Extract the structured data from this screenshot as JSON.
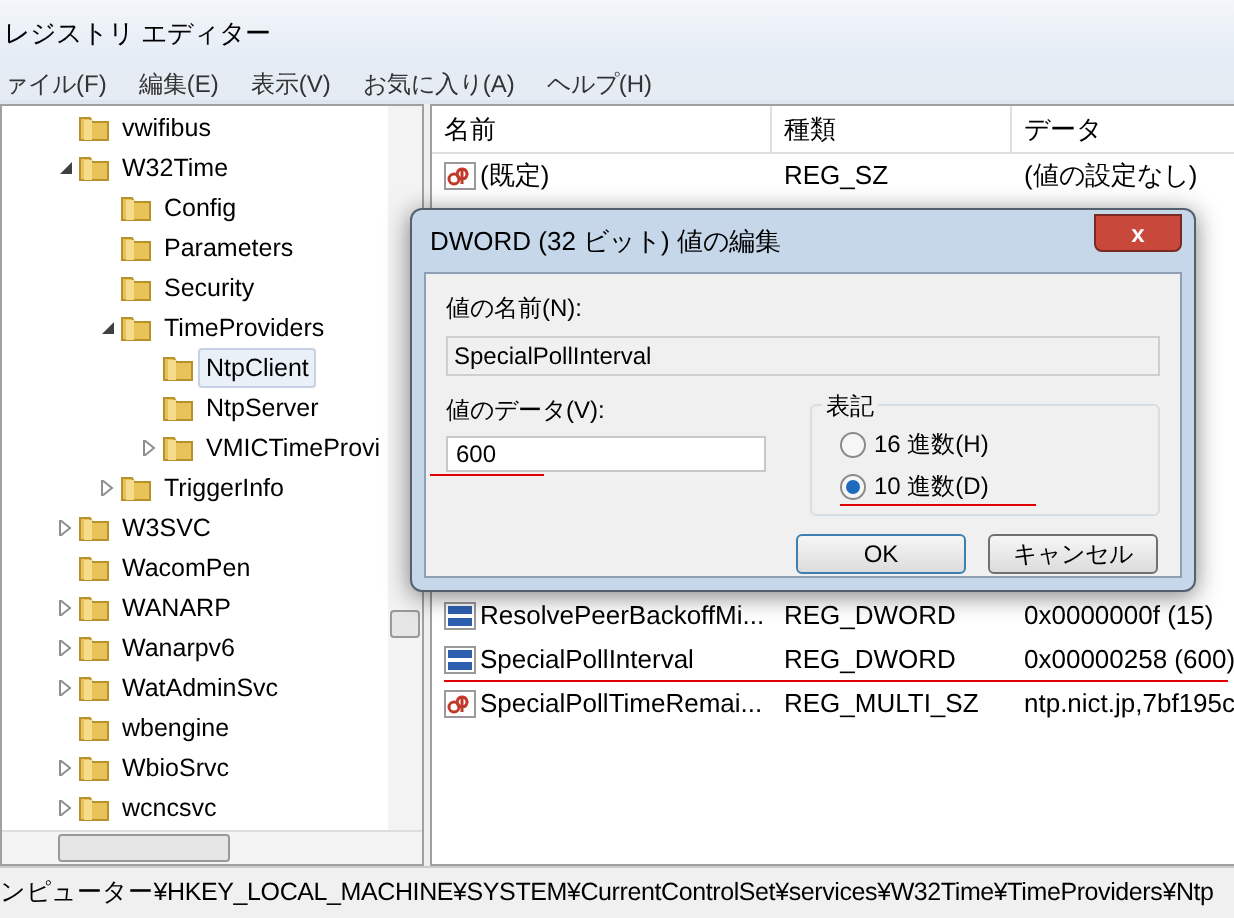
{
  "window": {
    "title": "レジストリ エディター"
  },
  "menu": [
    "ァイル(F)",
    "編集(E)",
    "表示(V)",
    "お気に入り(A)",
    "ヘルプ(H)"
  ],
  "tree": [
    {
      "label": "vwifibus",
      "selected": false
    },
    {
      "label": "W32Time",
      "selected": false,
      "expanded": true,
      "children": [
        {
          "label": "Config",
          "selected": false
        },
        {
          "label": "Parameters",
          "selected": false
        },
        {
          "label": "Security",
          "selected": false
        },
        {
          "label": "TimeProviders",
          "selected": false,
          "expanded": true,
          "children": [
            {
              "label": "NtpClient",
              "selected": true
            },
            {
              "label": "NtpServer",
              "selected": false
            },
            {
              "label": "VMICTimeProvi",
              "selected": false,
              "expanded": false
            }
          ]
        },
        {
          "label": "TriggerInfo",
          "selected": false,
          "expanded": false
        }
      ]
    },
    {
      "label": "W3SVC",
      "selected": false,
      "expanded": false
    },
    {
      "label": "WacomPen",
      "selected": false
    },
    {
      "label": "WANARP",
      "selected": false,
      "expanded": false
    },
    {
      "label": "Wanarpv6",
      "selected": false,
      "expanded": false
    },
    {
      "label": "WatAdminSvc",
      "selected": false,
      "expanded": false
    },
    {
      "label": "wbengine",
      "selected": false
    },
    {
      "label": "WbioSrvc",
      "selected": false,
      "expanded": false
    },
    {
      "label": "wcncsvc",
      "selected": false,
      "expanded": false
    }
  ],
  "table": {
    "columns": [
      "名前",
      "種類",
      "データ"
    ],
    "rows": [
      {
        "kind": "string",
        "name": "(既定)",
        "type": "REG_SZ",
        "data": "(値の設定なし)"
      },
      {
        "kind": "binary",
        "name": "ResolvePeerBackoffMi...",
        "type": "REG_DWORD",
        "data": "0x0000000f (15)"
      },
      {
        "kind": "binary",
        "name": "SpecialPollInterval",
        "type": "REG_DWORD",
        "data": "0x00000258 (600)"
      },
      {
        "kind": "string",
        "name": "SpecialPollTimeRemai...",
        "type": "REG_MULTI_SZ",
        "data": "ntp.nict.jp,7bf195c"
      }
    ]
  },
  "dialog": {
    "title": "DWORD (32 ビット) 値の編集",
    "close": "x",
    "name_label": "値の名前(N):",
    "name_value": "SpecialPollInterval",
    "data_label": "値のデータ(V):",
    "data_value": "600",
    "base_group": "表記",
    "radios": [
      {
        "label": "16 進数(H)",
        "selected": false
      },
      {
        "label": "10 進数(D)",
        "selected": true
      }
    ],
    "buttons": [
      "OK",
      "キャンセル"
    ]
  },
  "status_bar": "ンピューター¥HKEY_LOCAL_MACHINE¥SYSTEM¥CurrentControlSet¥services¥W32Time¥TimeProviders¥Ntp"
}
